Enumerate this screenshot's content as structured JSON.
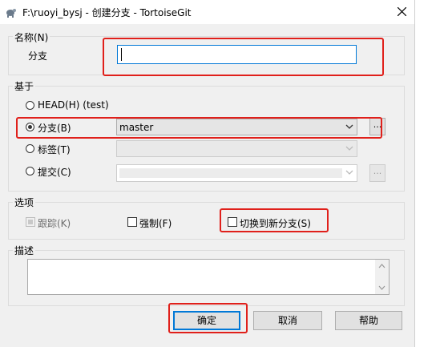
{
  "window": {
    "title": "F:\\ruoyi_bysj - 创建分支 - TortoiseGit",
    "close_icon": "close-icon"
  },
  "name_group": {
    "title": "名称(N)",
    "branch_label": "分支",
    "branch_value": ""
  },
  "base_group": {
    "title": "基于",
    "head_label": "HEAD(H) (test)",
    "branch_label": "分支(B)",
    "branch_value": "master",
    "tag_label": "标签(T)",
    "commit_label": "提交(C)",
    "browse_label": "...",
    "selected": "branch"
  },
  "options_group": {
    "title": "选项",
    "track_label": "跟踪(K)",
    "force_label": "强制(F)",
    "switch_label": "切换到新分支(S)"
  },
  "description_group": {
    "title": "描述"
  },
  "buttons": {
    "ok": "确定",
    "cancel": "取消",
    "help": "帮助"
  },
  "colors": {
    "highlight": "#e0201b",
    "focus": "#0078d7"
  }
}
